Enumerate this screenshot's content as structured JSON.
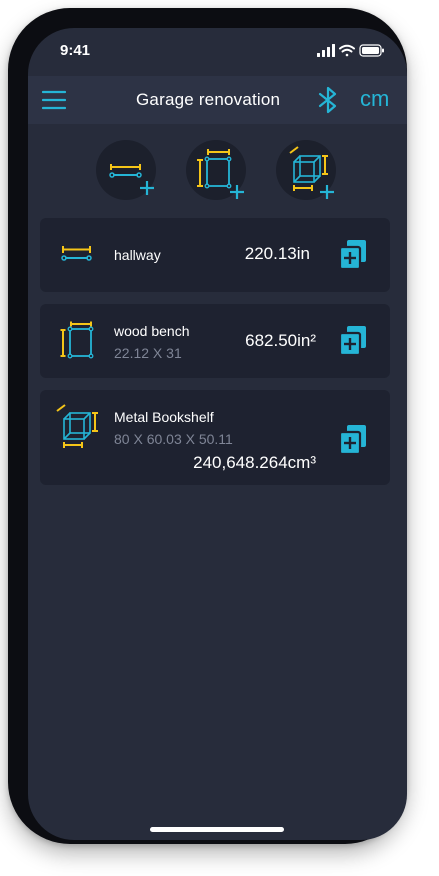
{
  "colors": {
    "accent": "#25b5d6",
    "dimension_yellow": "#f5c518",
    "background": "#272c3b",
    "card": "#1e2230",
    "text": "#ffffff",
    "muted": "#7f8596"
  },
  "status_bar": {
    "time": "9:41",
    "icons": [
      "signal-icon",
      "wifi-icon",
      "battery-icon"
    ]
  },
  "header": {
    "menu_icon": "hamburger-menu-icon",
    "title": "Garage renovation",
    "bluetooth_icon": "bluetooth-icon",
    "unit": "cm"
  },
  "add_buttons": [
    {
      "icon": "add-length-icon"
    },
    {
      "icon": "add-area-icon"
    },
    {
      "icon": "add-volume-icon"
    }
  ],
  "measurements": [
    {
      "icon": "length-icon",
      "name": "hallway",
      "dims": "",
      "value": "220.13in"
    },
    {
      "icon": "area-icon",
      "name": "wood bench",
      "dims": "22.12 X 31",
      "value": "682.50in²"
    },
    {
      "icon": "volume-icon",
      "name": "Metal Bookshelf",
      "dims": "80 X 60.03 X 50.11",
      "value": "240,648.264cm³"
    }
  ],
  "copy_icon": "copy-add-icon"
}
